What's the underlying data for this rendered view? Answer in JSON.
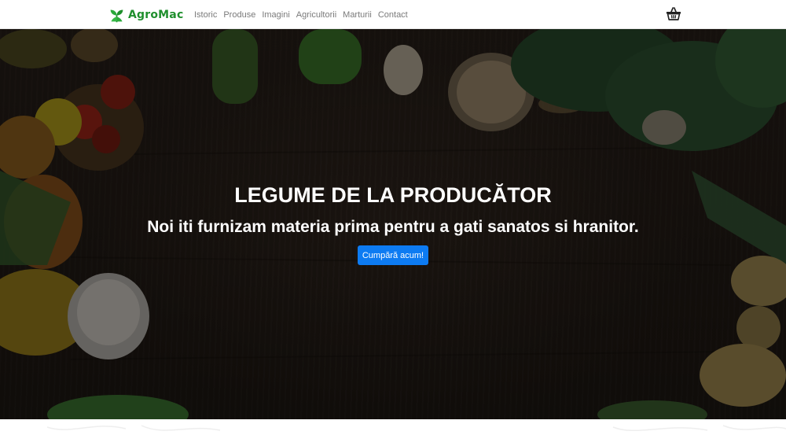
{
  "navbar": {
    "brand_name": "AgroMac",
    "brand_color": "#1f8f2d",
    "links": [
      "Istoric",
      "Produse",
      "Imagini",
      "Agricultorii",
      "Marturii",
      "Contact"
    ],
    "cart_icon": "basket-icon"
  },
  "hero": {
    "title": "LEGUME DE LA PRODUCĂTOR",
    "subtitle": "Noi iti furnizam materia prima pentru a gati sanatos si hranitor.",
    "button_label": "Cumpără acum!",
    "button_color": "#0d7bf2",
    "background": "dark-wood-with-vegetables"
  }
}
